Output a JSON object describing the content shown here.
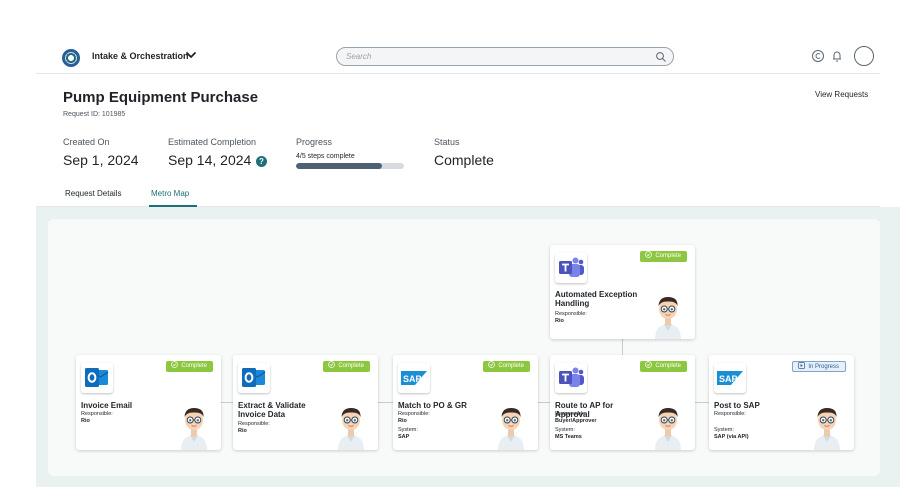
{
  "topbar": {
    "app_title": "Intake & Orchestration",
    "search_placeholder": "Search"
  },
  "header": {
    "title": "Pump Equipment Purchase",
    "request_id": "Request ID: 101985",
    "view_requests": "View Requests"
  },
  "stats": {
    "created_label": "Created On",
    "created_value": "Sep 1, 2024",
    "estimated_label": "Estimated Completion",
    "estimated_value": "Sep 14, 2024",
    "progress_label": "Progress",
    "progress_text": "4/5 steps complete",
    "progress_fraction": 0.8,
    "status_label": "Status",
    "status_value": "Complete"
  },
  "tabs": [
    {
      "label": "Request Details",
      "active": false
    },
    {
      "label": "Metro Map",
      "active": true
    }
  ],
  "colors": {
    "accent": "#1f6f7a",
    "complete": "#8dc63f",
    "in_progress": "#2d5f95"
  },
  "steps": [
    {
      "title": "Invoice Email",
      "app": "outlook-icon",
      "status": "Complete",
      "responsible_label": "Responsible:",
      "responsible": "Rio",
      "system_label": "",
      "system": ""
    },
    {
      "title": "Extract & Validate Invoice Data",
      "app": "outlook-icon",
      "status": "Complete",
      "responsible_label": "Responsible:",
      "responsible": "Rio",
      "system_label": "",
      "system": ""
    },
    {
      "title": "Match to PO & GR",
      "app": "sap-icon",
      "status": "Complete",
      "responsible_label": "Responsible:",
      "responsible": "Rio",
      "system_label": "System:",
      "system": "SAP"
    },
    {
      "title": "Route to AP for Approval",
      "app": "teams-icon",
      "status": "Complete",
      "responsible_label": "Responsible:",
      "responsible": "Buyer/Approver",
      "system_label": "System:",
      "system": "MS Teams"
    },
    {
      "title": "Post to SAP",
      "app": "sap-icon",
      "status": "In Progress",
      "responsible_label": "Responsible:",
      "responsible": "",
      "system_label": "System:",
      "system": "SAP (via API)"
    }
  ],
  "exception_step": {
    "title": "Automated Exception Handling",
    "app": "teams-icon",
    "status": "Complete",
    "responsible_label": "Responsible:",
    "responsible": "Rio"
  }
}
